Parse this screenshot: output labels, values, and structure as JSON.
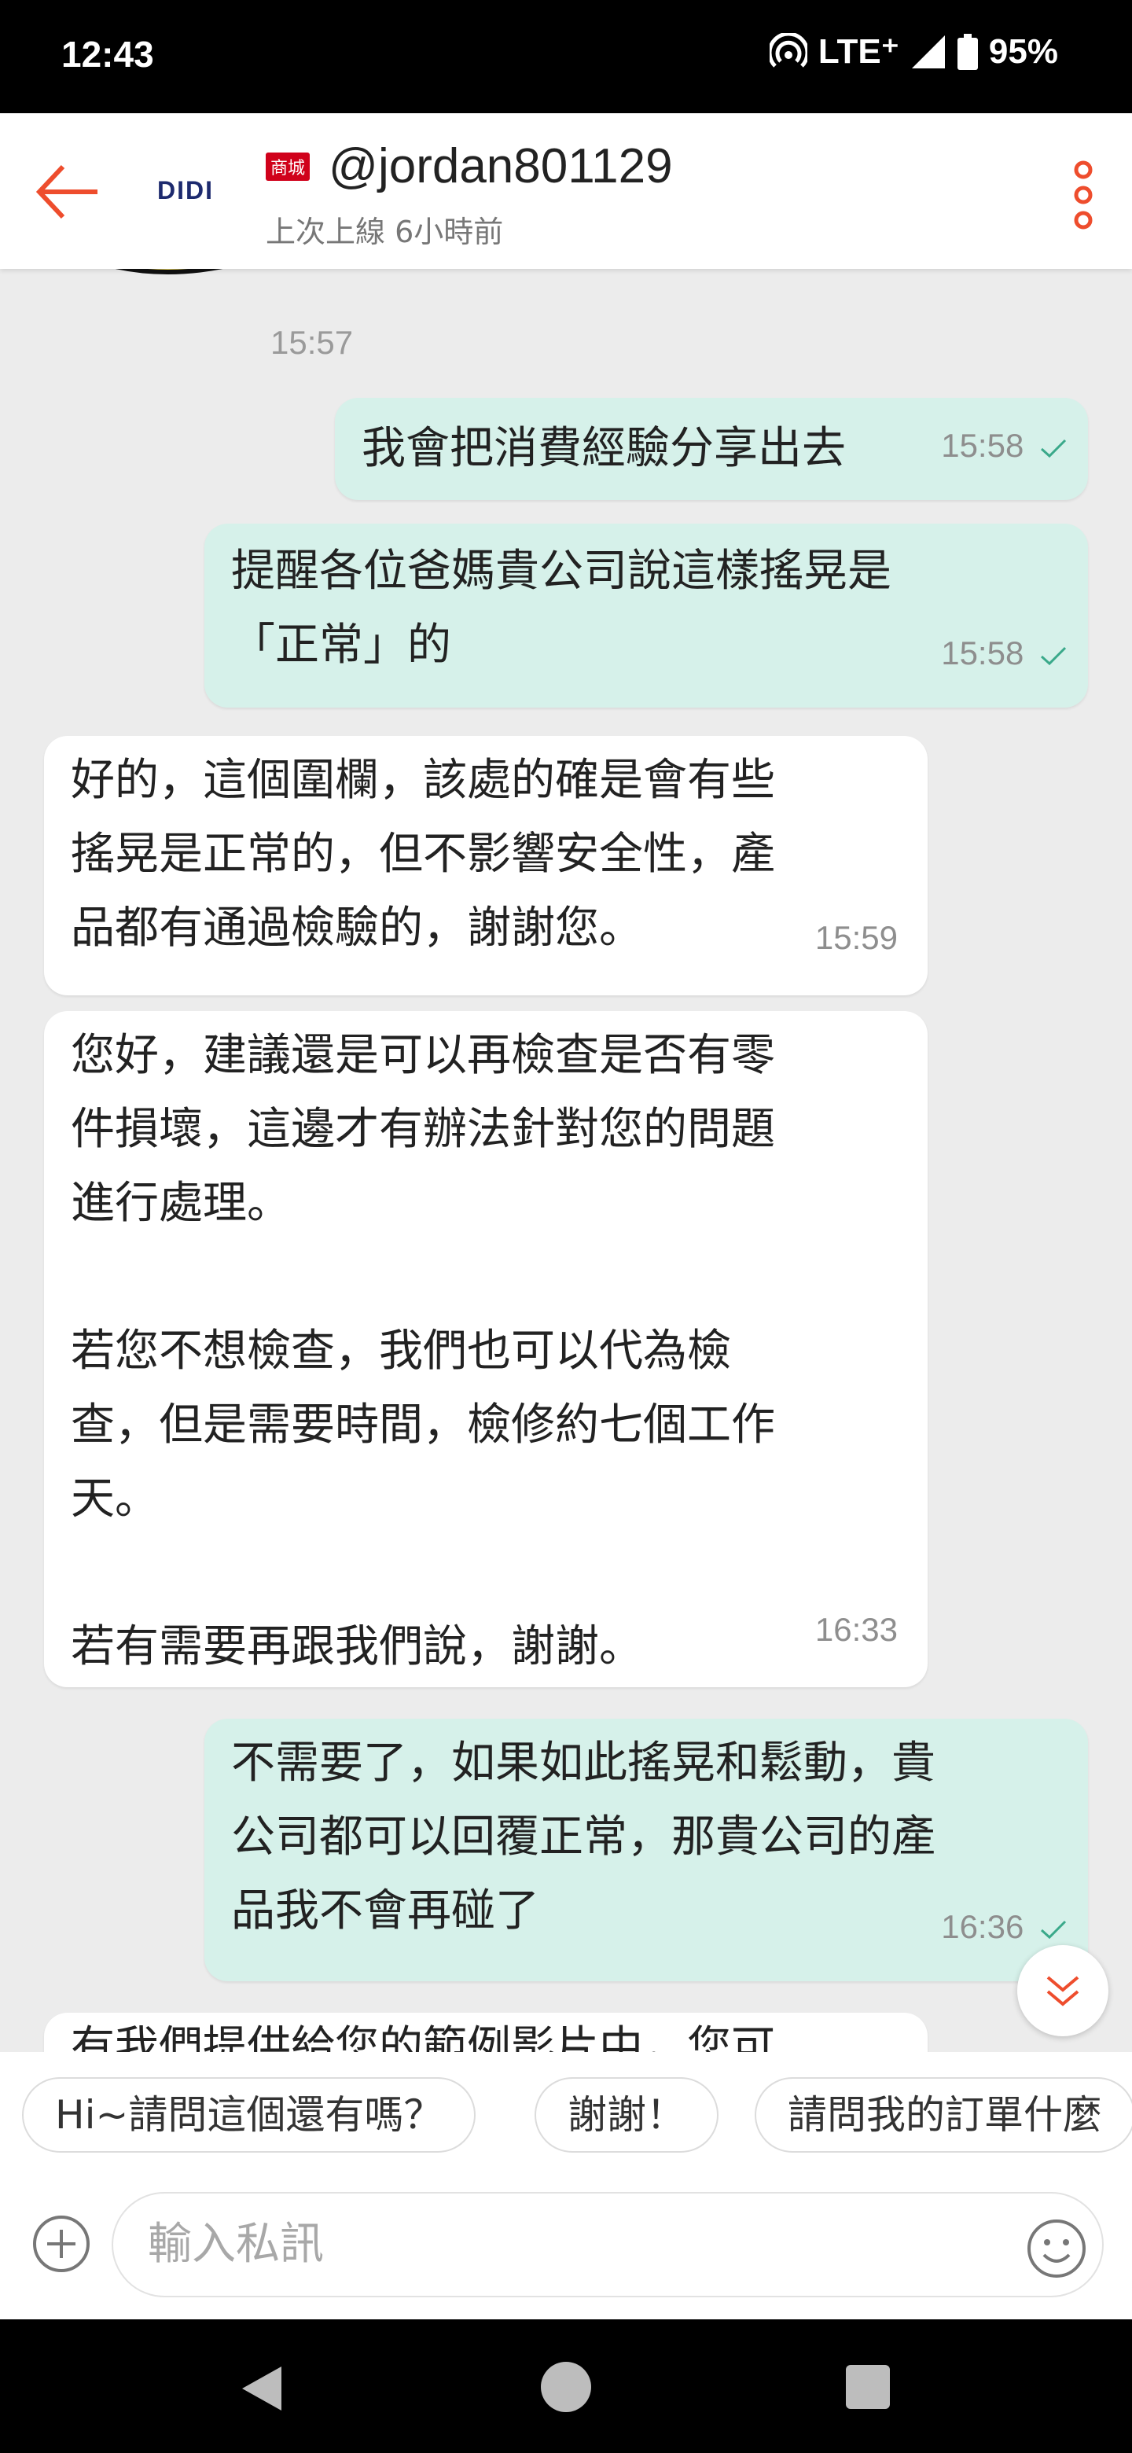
{
  "status_bar": {
    "time": "12:43",
    "network": "LTE⁺",
    "battery": "95%"
  },
  "header": {
    "logo_text": "DIDI",
    "badge": "商城",
    "shop_name": "@jordan801129",
    "last_seen": "上次上線 6小時前",
    "icons": {
      "back": "back-arrow-icon",
      "more": "more-vertical-icon"
    }
  },
  "chat": {
    "top_timestamp": "15:57",
    "messages": [
      {
        "direction": "outgoing",
        "text": "我會把消費經驗分享出去",
        "time": "15:58",
        "read": true
      },
      {
        "direction": "outgoing",
        "text": "提醒各位爸媽貴公司說這樣搖晃是\n「正常」的",
        "time": "15:58",
        "read": true
      },
      {
        "direction": "incoming",
        "text": "好的，這個圍欄，該處的確是會有些\n搖晃是正常的，但不影響安全性，產\n品都有通過檢驗的，謝謝您。",
        "time": "15:59"
      },
      {
        "direction": "incoming",
        "text": "您好，建議還是可以再檢查是否有零\n件損壞，這邊才有辦法針對您的問題\n進行處理。\n\n若您不想檢查，我們也可以代為檢\n查，但是需要時間，檢修約七個工作\n天。\n\n若有需要再跟我們說，謝謝。",
        "time": "16:33"
      },
      {
        "direction": "outgoing",
        "text": "不需要了，如果如此搖晃和鬆動，貴\n公司都可以回覆正常，那貴公司的產\n品我不會再碰了",
        "time": "16:36",
        "read": true
      },
      {
        "direction": "incoming",
        "text": "有我們提供給您的範例影片中，您可",
        "time": ""
      }
    ]
  },
  "quick_replies": [
    "Hi~請問這個還有嗎？",
    "謝謝！",
    "請問我的訂單什麼"
  ],
  "composer": {
    "placeholder": "輸入私訊",
    "icons": {
      "add": "plus-circle-icon",
      "emoji": "emoji-icon"
    }
  },
  "colors": {
    "accent": "#ee4d2d",
    "outgoing_bubble": "#d6f1ea",
    "incoming_bubble": "#ffffff",
    "tick": "#3aa98a"
  }
}
